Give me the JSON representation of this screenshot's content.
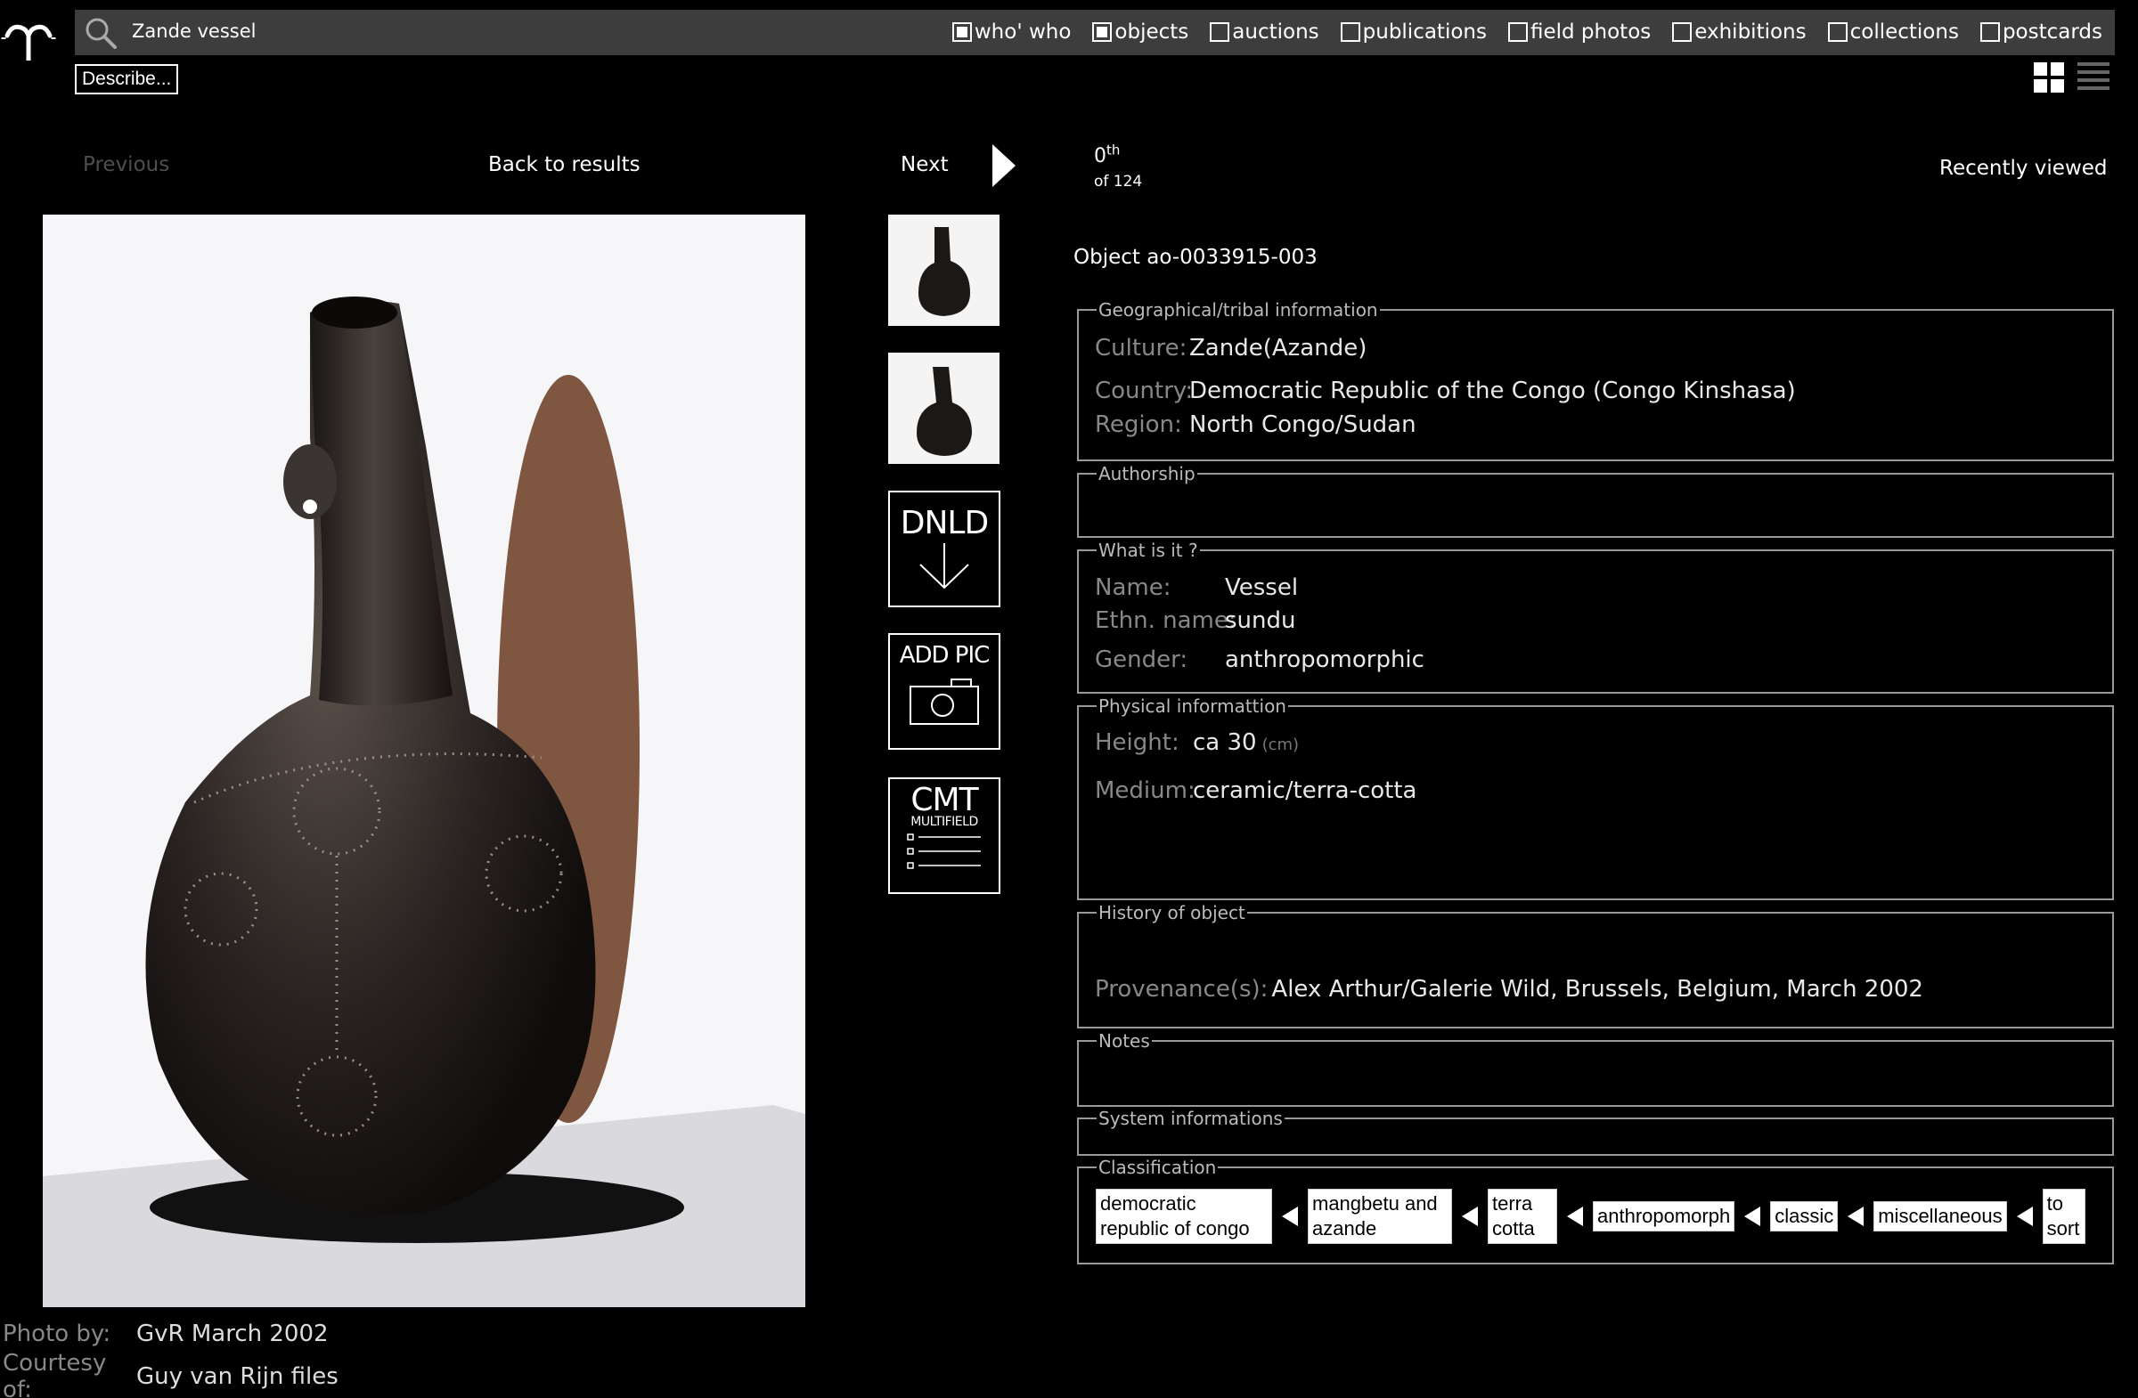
{
  "search": {
    "query": "Zande vessel"
  },
  "filters": [
    {
      "label": "who' who",
      "checked": true
    },
    {
      "label": "objects",
      "checked": true
    },
    {
      "label": "auctions",
      "checked": false
    },
    {
      "label": "publications",
      "checked": false
    },
    {
      "label": "field photos",
      "checked": false
    },
    {
      "label": "exhibitions",
      "checked": false
    },
    {
      "label": "collections",
      "checked": false
    },
    {
      "label": "postcards",
      "checked": false
    }
  ],
  "toolbar": {
    "describe_label": "Describe..."
  },
  "nav": {
    "previous_label": "Previous",
    "back_label": "Back to results",
    "next_label": "Next",
    "position": "0",
    "position_suffix": "th",
    "total": "of 124",
    "recent_label": "Recently viewed"
  },
  "photo": {
    "credits": [
      {
        "label": "Photo by:",
        "value": "GvR March 2002"
      },
      {
        "label": "Courtesy of:",
        "value": "Guy van Rijn files"
      }
    ]
  },
  "tools": {
    "download": "DNLD",
    "add_pic": "ADD PIC",
    "comment": "CMT",
    "comment_sub": "MULTIFIELD"
  },
  "object": {
    "title": "Object ao-0033915-003",
    "sections": {
      "geo": "Geographical/tribal information",
      "authorship": "Authorship",
      "what": "What is it ?",
      "physical": "Physical informattion",
      "history": "History of object",
      "notes": "Notes",
      "system": "System informations",
      "classification": "Classification"
    },
    "geo": {
      "culture_label": "Culture:",
      "culture": "Zande(Azande)",
      "country_label": "Country:",
      "country": "Democratic Republic of the Congo (Congo Kinshasa)",
      "region_label": "Region:",
      "region": "North Congo/Sudan"
    },
    "what": {
      "name_label": "Name:",
      "name": "Vessel",
      "ethn_label": "Ethn. name:",
      "ethn": "sundu",
      "gender_label": "Gender:",
      "gender": "anthropomorphic"
    },
    "physical": {
      "height_label": "Height:",
      "height": "ca 30",
      "height_unit": "(cm)",
      "medium_label": "Medium:",
      "medium": "ceramic/terra-cotta"
    },
    "history": {
      "provenance_label": "Provenance(s):",
      "provenance": "Alex Arthur/Galerie Wild, Brussels, Belgium, March 2002"
    },
    "classification": [
      "democratic republic of congo",
      "mangbetu and azande",
      "terra cotta",
      "anthropomorph",
      "classic",
      "miscellaneous",
      "to sort"
    ]
  }
}
